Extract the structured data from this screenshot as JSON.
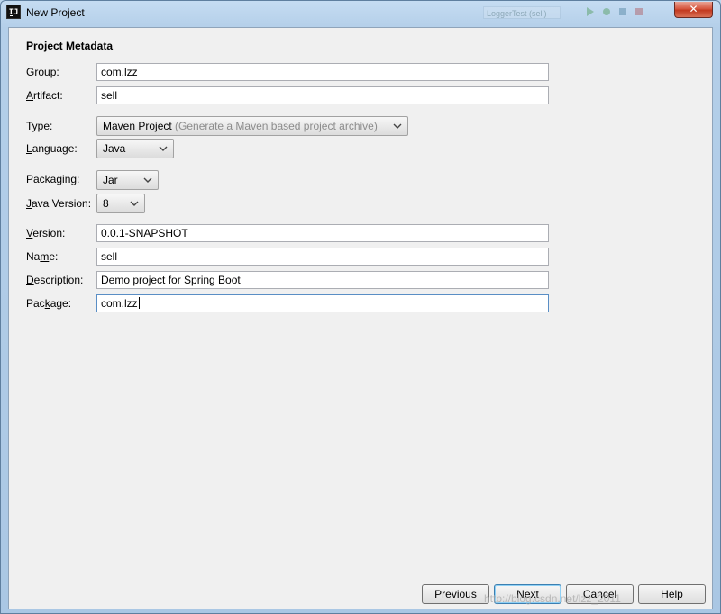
{
  "window": {
    "title": "New Project",
    "app_icon_text": "IJ",
    "close_glyph": "✕",
    "background_toolbar_text": "LoggerTest (sell)"
  },
  "section_title": "Project Metadata",
  "fields": {
    "group": {
      "label_key": "G",
      "label_rest": "roup:",
      "value": "com.lzz"
    },
    "artifact": {
      "label_key": "A",
      "label_rest": "rtifact:",
      "value": "sell"
    },
    "type": {
      "label_key": "T",
      "label_rest": "ype:",
      "value": "Maven Project",
      "hint": "(Generate a Maven based project archive)"
    },
    "language": {
      "label_key": "L",
      "label_rest": "anguage:",
      "value": "Java"
    },
    "packaging": {
      "label_pre": "Packa",
      "label_key": "g",
      "label_rest": "ing:",
      "value": "Jar"
    },
    "java_version": {
      "label_key": "J",
      "label_rest": "ava Version:",
      "value": "8"
    },
    "version": {
      "label_key": "V",
      "label_rest": "ersion:",
      "value": "0.0.1-SNAPSHOT"
    },
    "name": {
      "label_pre": "Na",
      "label_key": "m",
      "label_rest": "e:",
      "value": "sell"
    },
    "description": {
      "label_key": "D",
      "label_rest": "escription:",
      "value": "Demo project for Spring Boot"
    },
    "package": {
      "label_pre": "Pac",
      "label_key": "k",
      "label_rest": "age:",
      "value": "com.lzz"
    }
  },
  "buttons": {
    "previous": "Previous",
    "next": "Next",
    "cancel": "Cancel",
    "help": "Help"
  },
  "watermark": "http://blog.csdn.net/lzz_2011",
  "colors": {
    "titlebar": "#b4cfe9",
    "client_bg": "#f0f0f0",
    "focus_border": "#5a8ec5",
    "close_button": "#c23a20"
  }
}
